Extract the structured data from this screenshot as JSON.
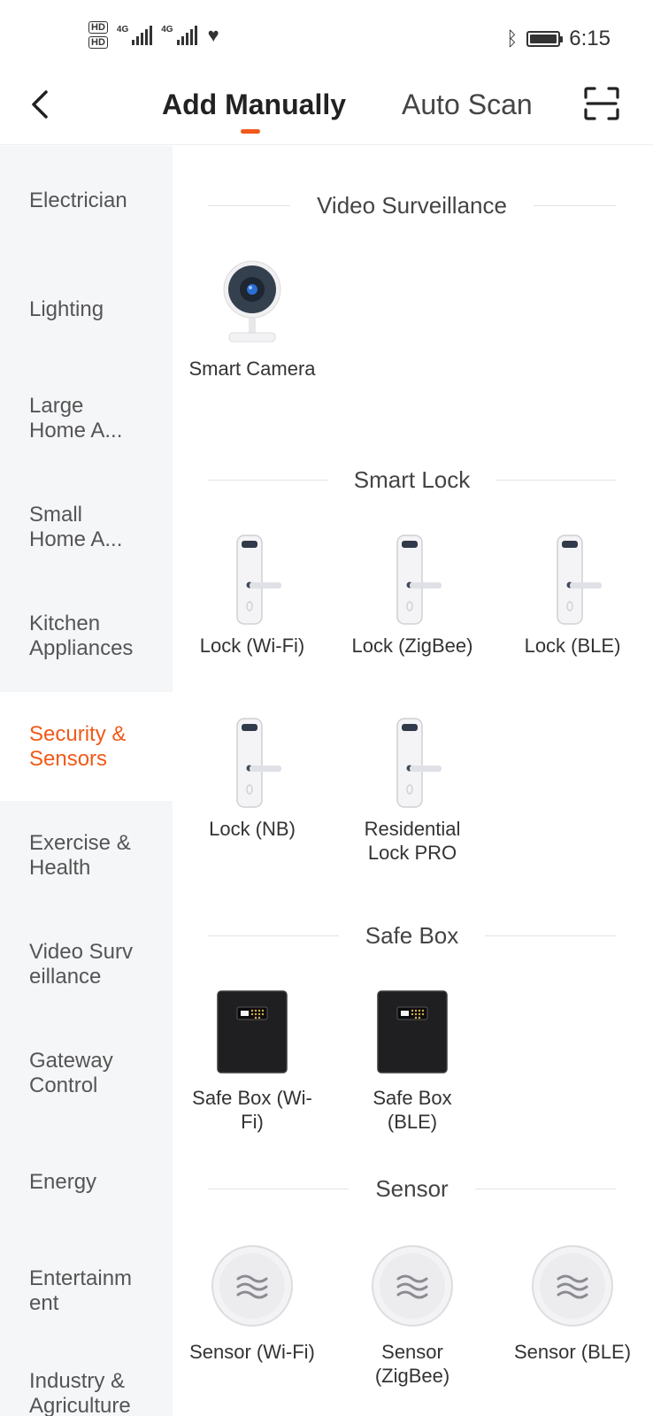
{
  "status_bar": {
    "hd1": "HD",
    "hd2": "HD",
    "net1": "4G",
    "net2": "4G",
    "time": "6:15"
  },
  "header": {
    "tab_manual": "Add Manually",
    "tab_scan": "Auto Scan"
  },
  "sidebar": {
    "items": [
      {
        "label": "Electrician"
      },
      {
        "label": "Lighting"
      },
      {
        "label": "Large Home A..."
      },
      {
        "label": "Small Home A..."
      },
      {
        "label": "Kitchen Appliances"
      },
      {
        "label": "Security & Sensors"
      },
      {
        "label": "Exercise & Health"
      },
      {
        "label": "Video Surv eillance"
      },
      {
        "label": "Gateway Control"
      },
      {
        "label": "Energy"
      },
      {
        "label": "Entertainm ent"
      },
      {
        "label": "Industry & Agriculture"
      }
    ]
  },
  "sections": {
    "video": {
      "title": "Video Surveillance",
      "devices": [
        {
          "label": "Smart Camera",
          "icon": "camera-icon"
        }
      ]
    },
    "lock": {
      "title": "Smart Lock",
      "devices": [
        {
          "label": "Lock (Wi-Fi)",
          "icon": "lock-icon"
        },
        {
          "label": "Lock (ZigBee)",
          "icon": "lock-icon"
        },
        {
          "label": "Lock (BLE)",
          "icon": "lock-icon"
        },
        {
          "label": "Lock (NB)",
          "icon": "lock-icon"
        },
        {
          "label": "Residential Lock PRO",
          "icon": "lock-icon"
        }
      ]
    },
    "safe": {
      "title": "Safe Box",
      "devices": [
        {
          "label": "Safe Box (Wi-Fi)",
          "icon": "safe-box-icon"
        },
        {
          "label": "Safe Box (BLE)",
          "icon": "safe-box-icon"
        }
      ]
    },
    "sensor": {
      "title": "Sensor",
      "devices": [
        {
          "label": "Sensor (Wi-Fi)",
          "icon": "sensor-icon"
        },
        {
          "label": "Sensor (ZigBee)",
          "icon": "sensor-icon"
        },
        {
          "label": "Sensor (BLE)",
          "icon": "sensor-icon"
        }
      ]
    }
  },
  "colors": {
    "accent": "#f05a1a",
    "sidebar_bg": "#f5f6f8"
  }
}
